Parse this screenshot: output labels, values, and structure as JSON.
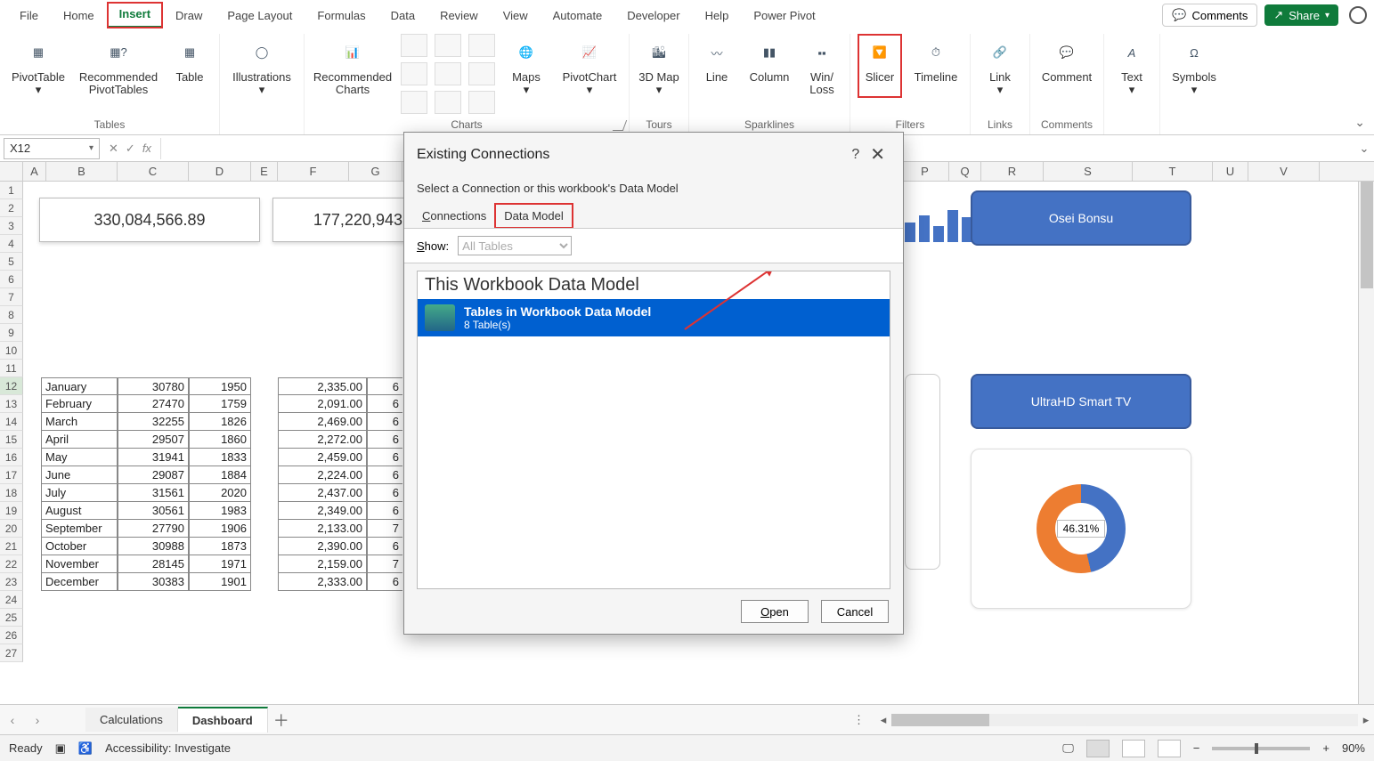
{
  "tabs": {
    "file": "File",
    "home": "Home",
    "insert": "Insert",
    "draw": "Draw",
    "pagelayout": "Page Layout",
    "formulas": "Formulas",
    "data": "Data",
    "review": "Review",
    "view": "View",
    "automate": "Automate",
    "developer": "Developer",
    "help": "Help",
    "powerpivot": "Power Pivot"
  },
  "topbar": {
    "comments": "Comments",
    "share": "Share"
  },
  "ribbon": {
    "tables": {
      "pivot": "PivotTable",
      "recpivot": "Recommended PivotTables",
      "table": "Table",
      "group": "Tables"
    },
    "illustrations": {
      "btn": "Illustrations"
    },
    "charts": {
      "rec": "Recommended Charts",
      "maps": "Maps",
      "pivotchart": "PivotChart",
      "group": "Charts"
    },
    "tours": {
      "map3d": "3D Map",
      "group": "Tours"
    },
    "sparklines": {
      "line": "Line",
      "column": "Column",
      "winloss": "Win/\nLoss",
      "group": "Sparklines"
    },
    "filters": {
      "slicer": "Slicer",
      "timeline": "Timeline",
      "group": "Filters"
    },
    "links": {
      "link": "Link",
      "group": "Links"
    },
    "comments": {
      "comment": "Comment",
      "group": "Comments"
    },
    "text": {
      "text": "Text"
    },
    "symbols": {
      "symbols": "Symbols"
    }
  },
  "namebox": "X12",
  "columns": [
    "A",
    "B",
    "C",
    "D",
    "E",
    "F",
    "G",
    "P",
    "Q",
    "R",
    "S",
    "T",
    "U",
    "V"
  ],
  "cards": {
    "val1": "330,084,566.89",
    "val2": "177,220,943"
  },
  "table": {
    "rows": [
      {
        "m": "January",
        "c1": "30780",
        "c2": "1950",
        "c3": "2,335.00",
        "c4": "6"
      },
      {
        "m": "February",
        "c1": "27470",
        "c2": "1759",
        "c3": "2,091.00",
        "c4": "6"
      },
      {
        "m": "March",
        "c1": "32255",
        "c2": "1826",
        "c3": "2,469.00",
        "c4": "6"
      },
      {
        "m": "April",
        "c1": "29507",
        "c2": "1860",
        "c3": "2,272.00",
        "c4": "6"
      },
      {
        "m": "May",
        "c1": "31941",
        "c2": "1833",
        "c3": "2,459.00",
        "c4": "6"
      },
      {
        "m": "June",
        "c1": "29087",
        "c2": "1884",
        "c3": "2,224.00",
        "c4": "6"
      },
      {
        "m": "July",
        "c1": "31561",
        "c2": "2020",
        "c3": "2,437.00",
        "c4": "6"
      },
      {
        "m": "August",
        "c1": "30561",
        "c2": "1983",
        "c3": "2,349.00",
        "c4": "6"
      },
      {
        "m": "September",
        "c1": "27790",
        "c2": "1906",
        "c3": "2,133.00",
        "c4": "7"
      },
      {
        "m": "October",
        "c1": "30988",
        "c2": "1873",
        "c3": "2,390.00",
        "c4": "6"
      },
      {
        "m": "November",
        "c1": "28145",
        "c2": "1971",
        "c3": "2,159.00",
        "c4": "7"
      },
      {
        "m": "December",
        "c1": "30383",
        "c2": "1901",
        "c3": "2,333.00",
        "c4": "6"
      }
    ]
  },
  "pills": {
    "p1": "Osei Bonsu",
    "p2": "UltraHD Smart TV"
  },
  "donut": {
    "label": "46.31%"
  },
  "dialog": {
    "title": "Existing Connections",
    "subtitle": "Select a Connection or this workbook's Data Model",
    "tab_connections": "Connections",
    "tab_connections_ul": "C",
    "tab_datamodel": "Data Model",
    "show": "Show:",
    "show_ul": "S",
    "show_value": "All Tables",
    "list_header": "This Workbook Data Model",
    "item_title": "Tables in Workbook Data Model",
    "item_sub": "8 Table(s)",
    "open": "Open",
    "open_ul": "O",
    "cancel": "Cancel"
  },
  "sheets": {
    "s1": "Calculations",
    "s2": "Dashboard"
  },
  "status": {
    "ready": "Ready",
    "acc": "Accessibility: Investigate",
    "zoom": "90%"
  },
  "chart_data": {
    "type": "bar",
    "categories": [
      "",
      "",
      "",
      "",
      ""
    ],
    "values": [
      22,
      30,
      18,
      36,
      28
    ],
    "note": "partial bar chart visible at right edge behind dialog; values estimated from pixel heights only"
  }
}
